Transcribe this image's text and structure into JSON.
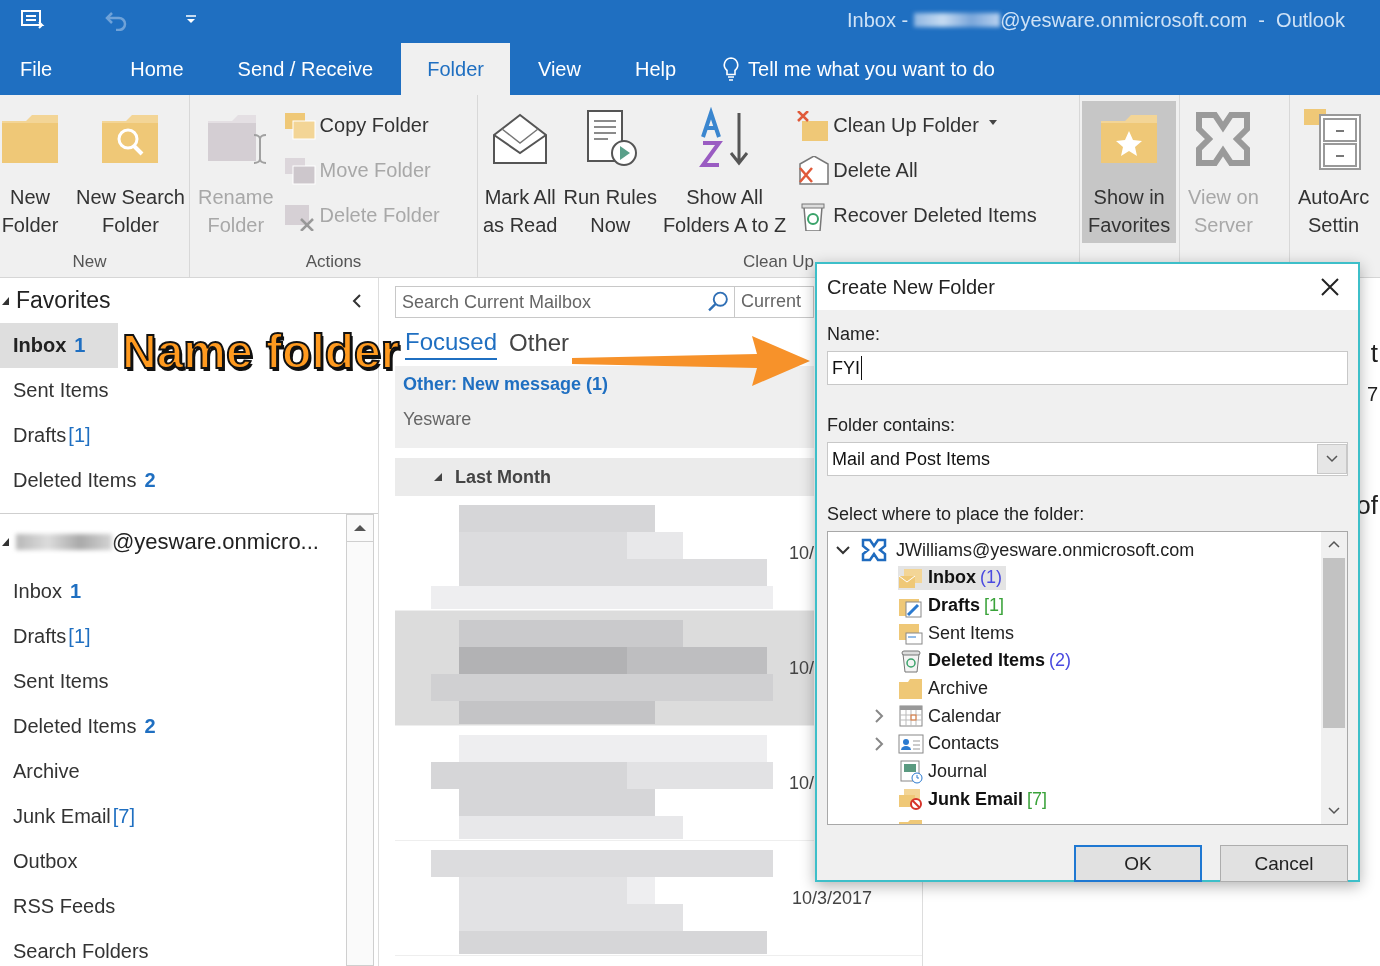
{
  "title_bar": {
    "title_start": "Inbox -",
    "title_end": "@yesware.onmicrosoft.com  -  Outlook"
  },
  "menu_tabs": [
    {
      "label": "File",
      "selected": false
    },
    {
      "label": "Home",
      "selected": false
    },
    {
      "label": "Send / Receive",
      "selected": false
    },
    {
      "label": "Folder",
      "selected": true
    },
    {
      "label": "View",
      "selected": false
    },
    {
      "label": "Help",
      "selected": false
    }
  ],
  "tell_me": "Tell me what you want to do",
  "ribbon": {
    "groups": [
      {
        "label": "New",
        "large": [
          {
            "lines": [
              "New",
              "Folder"
            ],
            "disabled": false,
            "pressed": false
          },
          {
            "lines": [
              "New Search",
              "Folder"
            ],
            "disabled": false,
            "pressed": false
          }
        ]
      },
      {
        "label": "Actions",
        "large": [
          {
            "lines": [
              "Rename",
              "Folder"
            ],
            "disabled": true,
            "pressed": false
          }
        ],
        "small": [
          {
            "label": "Copy Folder",
            "disabled": false,
            "dropdown": false
          },
          {
            "label": "Move Folder",
            "disabled": true,
            "dropdown": false
          },
          {
            "label": "Delete Folder",
            "disabled": true,
            "dropdown": false
          }
        ]
      },
      {
        "label": "Clean Up",
        "large": [
          {
            "lines": [
              "Mark All",
              "as Read"
            ],
            "disabled": false,
            "pressed": false
          },
          {
            "lines": [
              "Run Rules",
              "Now"
            ],
            "disabled": false,
            "pressed": false
          },
          {
            "lines": [
              "Show All",
              "Folders A to Z"
            ],
            "disabled": false,
            "pressed": false
          }
        ],
        "small": [
          {
            "label": "Clean Up Folder",
            "disabled": false,
            "dropdown": true
          },
          {
            "label": "Delete All",
            "disabled": false,
            "dropdown": false
          },
          {
            "label": "Recover Deleted Items",
            "disabled": false,
            "dropdown": false
          }
        ]
      },
      {
        "large": [
          {
            "lines": [
              "Show in",
              "Favorites"
            ],
            "disabled": false,
            "pressed": true
          }
        ]
      },
      {
        "large": [
          {
            "lines": [
              "View on",
              "Server"
            ],
            "disabled": true,
            "pressed": false
          }
        ]
      },
      {
        "large": [
          {
            "lines": [
              "AutoArc",
              "Settin"
            ],
            "disabled": false,
            "pressed": false
          }
        ]
      }
    ]
  },
  "favorites": {
    "title": "Favorites",
    "items": [
      {
        "name": "Inbox",
        "count": "1",
        "kind": "unread",
        "selected": true
      },
      {
        "name": "Sent Items",
        "selected": false
      },
      {
        "name": "Drafts",
        "count": "[1]",
        "kind": "total",
        "selected": false
      },
      {
        "name": "Deleted Items",
        "count": "2",
        "kind": "unread",
        "selected": false
      }
    ]
  },
  "mailbox": {
    "address": "@yesware.onmicro...",
    "items": [
      {
        "name": "Inbox",
        "count": "1",
        "kind": "unread",
        "selected": false
      },
      {
        "name": "Drafts",
        "count": "[1]",
        "kind": "total",
        "selected": false
      },
      {
        "name": "Sent Items",
        "selected": false
      },
      {
        "name": "Deleted Items",
        "count": "2",
        "kind": "unread",
        "selected": false
      },
      {
        "name": "Archive",
        "selected": false
      },
      {
        "name": "Junk Email",
        "count": "[7]",
        "kind": "total",
        "selected": false
      },
      {
        "name": "Outbox",
        "selected": false
      },
      {
        "name": "RSS Feeds",
        "selected": false
      },
      {
        "name": "Search Folders",
        "selected": false
      }
    ]
  },
  "message_list": {
    "search_placeholder": "Search Current Mailbox",
    "scope": "Current",
    "tabs": [
      {
        "label": "Focused",
        "selected": true
      },
      {
        "label": "Other",
        "selected": false
      }
    ],
    "notice": {
      "title": "Other: New message (1)",
      "sender": "Yesware"
    },
    "group": "Last Month",
    "rows": [
      {
        "date": "10/",
        "selected": false
      },
      {
        "date": "10/",
        "selected": true
      },
      {
        "date": "10/",
        "selected": false
      },
      {
        "date": "10/3/2017",
        "selected": false
      }
    ]
  },
  "reading_pane": {
    "fragments": [
      "t",
      "7",
      "of"
    ]
  },
  "annotation": {
    "text": "Name folder"
  },
  "dialog": {
    "title": "Create New Folder",
    "name_label": "Name:",
    "name_value": "FYI",
    "contains_label": "Folder contains:",
    "contains_value": "Mail and Post Items",
    "place_label": "Select where to place the folder:",
    "tree": {
      "label": "JWilliams@yesware.onmicrosoft.com",
      "expanded": true,
      "children": [
        {
          "label": "Inbox",
          "count": "(1)",
          "kind": "unread",
          "bold": true,
          "selected": true,
          "has_children": false
        },
        {
          "label": "Drafts",
          "count": "[1]",
          "kind": "total",
          "bold": true,
          "selected": false,
          "has_children": false
        },
        {
          "label": "Sent Items",
          "bold": false,
          "selected": false,
          "has_children": false
        },
        {
          "label": "Deleted Items",
          "count": "(2)",
          "kind": "unread",
          "bold": true,
          "selected": false,
          "has_children": false
        },
        {
          "label": "Archive",
          "bold": false,
          "selected": false,
          "has_children": false
        },
        {
          "label": "Calendar",
          "bold": false,
          "selected": false,
          "has_children": true
        },
        {
          "label": "Contacts",
          "bold": false,
          "selected": false,
          "has_children": true
        },
        {
          "label": "Journal",
          "bold": false,
          "selected": false,
          "has_children": false
        },
        {
          "label": "Junk Email",
          "count": "[7]",
          "kind": "total",
          "bold": true,
          "selected": false,
          "has_children": false
        }
      ]
    },
    "buttons": [
      {
        "label": "OK",
        "default": true
      },
      {
        "label": "Cancel",
        "default": false
      }
    ]
  }
}
